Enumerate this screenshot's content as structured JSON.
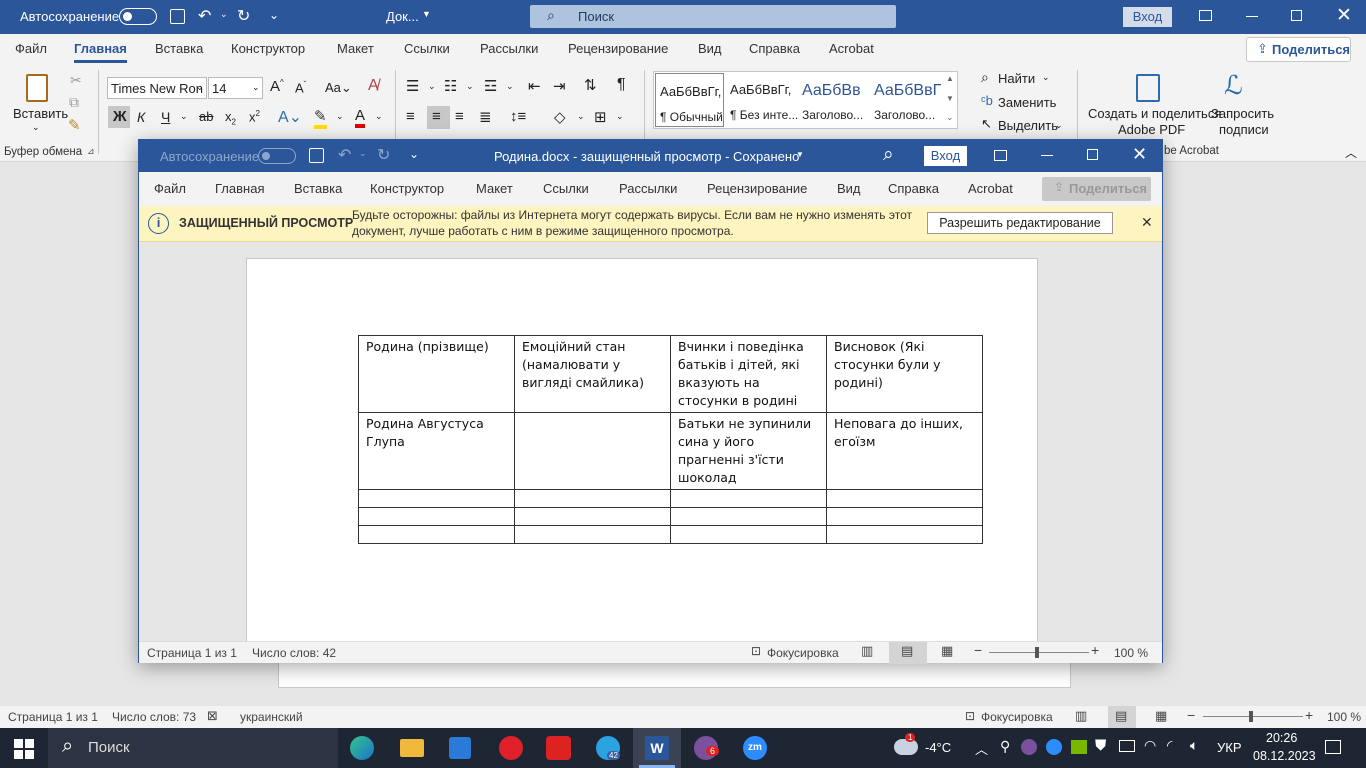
{
  "bg": {
    "autosave": "Автосохранение",
    "doc_title": "Док...",
    "search_placeholder": "Поиск",
    "signin": "Вход",
    "share": "Поделиться",
    "menu": [
      "Файл",
      "Главная",
      "Вставка",
      "Конструктор",
      "Макет",
      "Ссылки",
      "Рассылки",
      "Рецензирование",
      "Вид",
      "Справка",
      "Acrobat"
    ],
    "ribbon": {
      "paste": "Вставить",
      "font_name": "Times New Ron",
      "font_size": "14",
      "clipboard_group": "Буфер обмена",
      "styles": [
        {
          "preview": "АаБбВвГг,",
          "name": "¶ Обычный"
        },
        {
          "preview": "АаБбВвГг,",
          "name": "¶ Без инте..."
        },
        {
          "preview": "АаБбВв",
          "name": "Заголово..."
        },
        {
          "preview": "АаБбВвГ",
          "name": "Заголово..."
        }
      ],
      "find": "Найти",
      "replace": "Заменить",
      "select": "Выделить",
      "create_pdf": "Создать и поделиться",
      "create_pdf2": "Adobe PDF",
      "request_sign": "Запросить",
      "request_sign2": "подписи",
      "acrobat_group": "be Acrobat"
    },
    "status": {
      "page": "Страница 1 из 1",
      "words": "Число слов: 73",
      "lang": "украинский",
      "focus": "Фокусировка",
      "zoom": "100 %"
    }
  },
  "win": {
    "autosave": "Автосохранение",
    "title": "Родина.docx  -  защищенный просмотр  -  Сохранено",
    "signin": "Вход",
    "share": "Поделиться",
    "menu": [
      "Файл",
      "Главная",
      "Вставка",
      "Конструктор",
      "Макет",
      "Ссылки",
      "Рассылки",
      "Рецензирование",
      "Вид",
      "Справка",
      "Acrobat"
    ],
    "protected": {
      "label": "ЗАЩИЩЕННЫЙ ПРОСМОТР",
      "line1": "Будьте осторожны: файлы из Интернета могут содержать вирусы. Если вам не нужно изменять этот",
      "line2": "документ, лучше работать с ним в режиме защищенного просмотра.",
      "button": "Разрешить редактирование"
    },
    "table": {
      "rows": [
        [
          "Родина (прізвище)",
          "Емоційний стан (намалювати у вигляді смайлика)",
          "Вчинки і поведінка батьків і дітей, які вказують на стосунки в родині",
          "Висновок (Які стосунки були у родині)"
        ],
        [
          "Родина Августуса Глупа",
          "",
          "Батьки не зупинили сина у його прагненні з'їсти шоколад",
          "Неповага до інших, егоїзм"
        ],
        [
          "",
          "",
          "",
          ""
        ],
        [
          "",
          "",
          "",
          ""
        ],
        [
          "",
          "",
          "",
          ""
        ]
      ]
    },
    "status": {
      "page": "Страница 1 из 1",
      "words": "Число слов: 42",
      "focus": "Фокусировка",
      "zoom": "100 %"
    }
  },
  "taskbar": {
    "search": "Поиск",
    "weather": "-4°C",
    "lang": "УКР",
    "time": "20:26",
    "date": "08.12.2023",
    "badges": {
      "telegram": "42",
      "viber": "6",
      "weather": "1"
    }
  },
  "colors": {
    "word_blue": "#2b579a",
    "protected_bg": "#fdf4bf",
    "taskbar": "#1f2633"
  }
}
